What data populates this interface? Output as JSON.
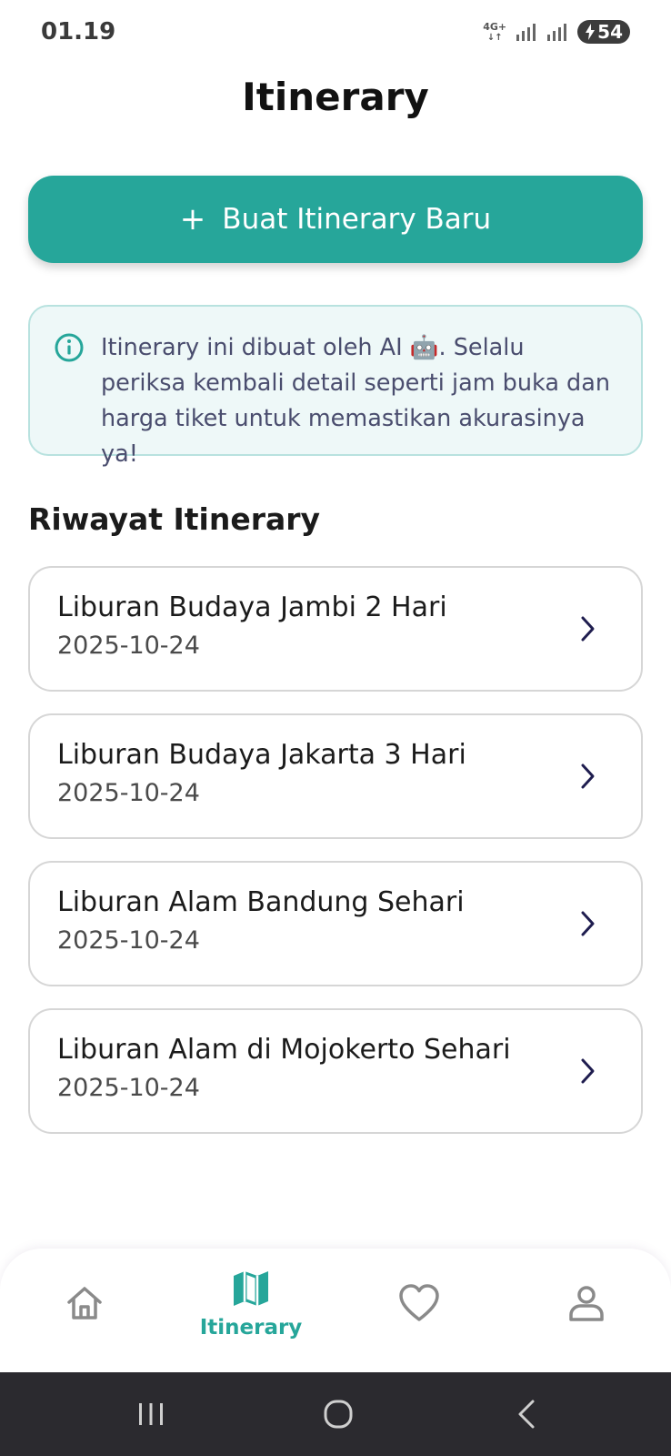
{
  "status_bar": {
    "time": "01.19",
    "network": "4G+",
    "battery": "54"
  },
  "header": {
    "title": "Itinerary"
  },
  "create_button": {
    "label": "Buat Itinerary Baru"
  },
  "info": {
    "text": "Itinerary ini dibuat oleh AI 🤖. Selalu periksa kembali detail seperti jam buka dan harga tiket untuk memastikan akurasinya ya!"
  },
  "history": {
    "title": "Riwayat Itinerary",
    "items": [
      {
        "title": "Liburan Budaya Jambi 2 Hari",
        "date": "2025-10-24"
      },
      {
        "title": "Liburan Budaya Jakarta 3 Hari",
        "date": "2025-10-24"
      },
      {
        "title": "Liburan Alam Bandung Sehari",
        "date": "2025-10-24"
      },
      {
        "title": "Liburan Alam di Mojokerto Sehari",
        "date": "2025-10-24"
      }
    ]
  },
  "bottom_nav": {
    "active_label": "Itinerary",
    "items": [
      {
        "icon": "home-icon"
      },
      {
        "icon": "map-icon"
      },
      {
        "icon": "heart-icon"
      },
      {
        "icon": "profile-icon"
      }
    ]
  },
  "colors": {
    "accent": "#26a69a",
    "info_bg": "#eef8f8",
    "info_border": "#b8e2df",
    "nav_dark": "#2b2a2f"
  }
}
